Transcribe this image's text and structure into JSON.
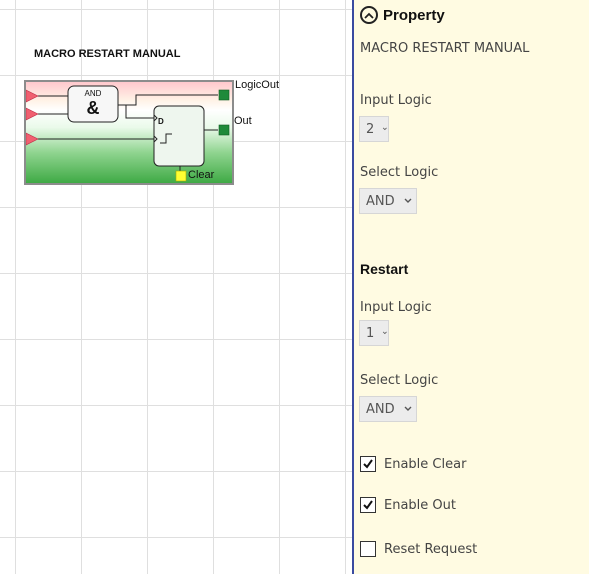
{
  "block": {
    "title": "MACRO RESTART MANUAL",
    "and_gate_label": "AND",
    "and_gate_symbol": "&",
    "flipflop_d_label": "D",
    "pins": {
      "logic_out": "LogicOut",
      "out": "Out",
      "clear": "Clear"
    }
  },
  "property": {
    "header": "Property",
    "subtitle": "MACRO RESTART MANUAL",
    "input_logic": {
      "label": "Input Logic",
      "value": "2"
    },
    "select_logic": {
      "label": "Select Logic",
      "value": "AND"
    },
    "restart": {
      "heading": "Restart",
      "input_logic": {
        "label": "Input Logic",
        "value": "1"
      },
      "select_logic": {
        "label": "Select Logic",
        "value": "AND"
      }
    },
    "checkboxes": [
      {
        "label": "Enable Clear",
        "checked": true
      },
      {
        "label": "Enable Out",
        "checked": true
      },
      {
        "label": "Reset Request",
        "checked": false
      }
    ]
  },
  "colors": {
    "panel_background": "#fffbe2",
    "panel_border": "#3a4ba0",
    "input_pin": "#f06070",
    "output_pin": "#1f8a3a",
    "clear_pin": "#ffff33"
  }
}
